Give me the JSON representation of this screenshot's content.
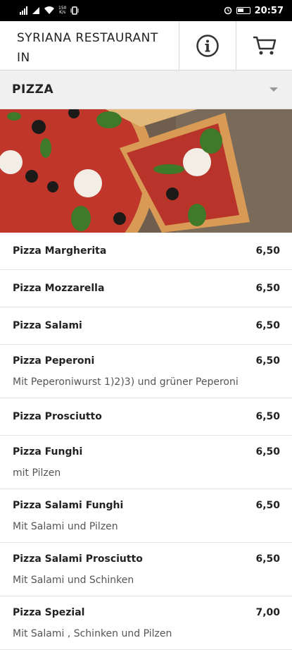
{
  "status": {
    "speed_top": "150",
    "speed_bottom": "K/s",
    "time": "20:57"
  },
  "header": {
    "title_line1": "SYRIANA RESTAURANT",
    "title_line2": "IN"
  },
  "category": {
    "label": "PIZZA"
  },
  "items": [
    {
      "name": "Pizza Margherita",
      "price": "6,50",
      "desc": ""
    },
    {
      "name": "Pizza Mozzarella",
      "price": "6,50",
      "desc": ""
    },
    {
      "name": "Pizza Salami",
      "price": "6,50",
      "desc": ""
    },
    {
      "name": "Pizza Peperoni",
      "price": "6,50",
      "desc": "Mit Peperoniwurst 1)2)3) und grüner Peperoni"
    },
    {
      "name": "Pizza Prosciutto",
      "price": "6,50",
      "desc": ""
    },
    {
      "name": "Pizza Funghi",
      "price": "6,50",
      "desc": "mit Pilzen"
    },
    {
      "name": "Pizza Salami Funghi",
      "price": "6,50",
      "desc": "Mit Salami und Pilzen"
    },
    {
      "name": "Pizza Salami Prosciutto",
      "price": "6,50",
      "desc": "Mit Salami und Schinken"
    },
    {
      "name": "Pizza Spezial",
      "price": "7,00",
      "desc": "Mit Salami , Schinken und Pilzen"
    }
  ],
  "icons": {
    "info": "info-icon",
    "cart": "cart-icon",
    "dropdown": "chevron-down-icon"
  }
}
